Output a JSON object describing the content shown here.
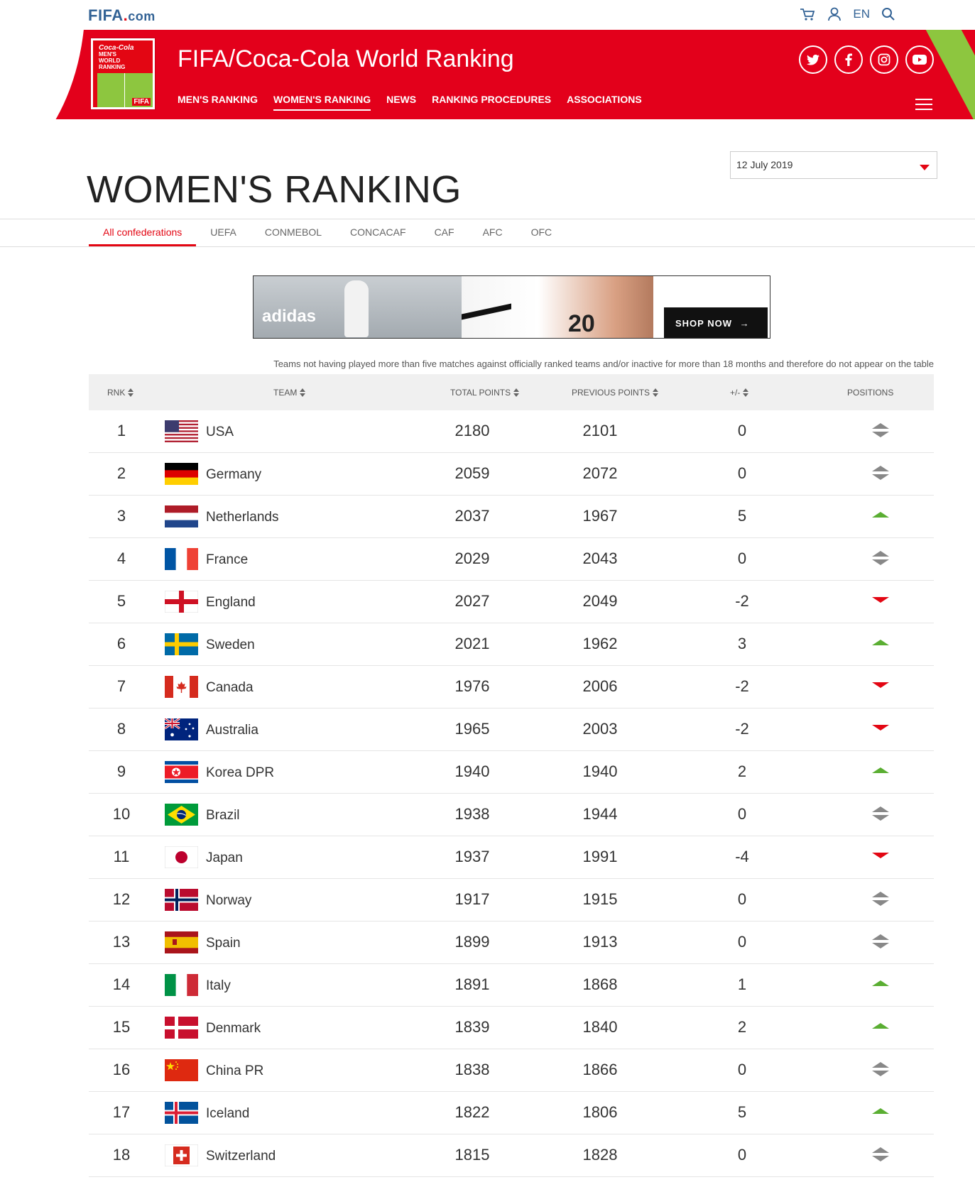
{
  "header": {
    "logo_main": "FIFA",
    "logo_dot": ".",
    "logo_suffix": "com",
    "language": "EN"
  },
  "banner": {
    "title": "FIFA/Coca-Cola World Ranking",
    "badge_lines": [
      "Coca-Cola",
      "MEN'S",
      "WORLD",
      "RANKING"
    ],
    "badge_fifa": "FIFA",
    "nav": [
      {
        "label": "MEN'S RANKING"
      },
      {
        "label": "WOMEN'S RANKING"
      },
      {
        "label": "NEWS"
      },
      {
        "label": "RANKING PROCEDURES"
      },
      {
        "label": "ASSOCIATIONS"
      }
    ],
    "active_nav": 1
  },
  "page": {
    "title": "WOMEN'S RANKING",
    "date": "12 July 2019"
  },
  "confederations": {
    "tabs": [
      "All confederations",
      "UEFA",
      "CONMEBOL",
      "CONCACAF",
      "CAF",
      "AFC",
      "OFC"
    ],
    "active": 0
  },
  "ad": {
    "brand": "adidas",
    "shirt_number": "20",
    "cta": "SHOP NOW"
  },
  "note": "Teams not having played more than five matches against officially ranked teams and/or inactive for more than 18 months and therefore do not appear on the table",
  "table": {
    "headers": {
      "rank": "RNK",
      "team": "TEAM",
      "total": "TOTAL POINTS",
      "previous": "PREVIOUS POINTS",
      "diff": "+/-",
      "positions": "POSITIONS"
    },
    "rows": [
      {
        "rank": "1",
        "team": "USA",
        "flag": "us",
        "total": "2180",
        "prev": "2101",
        "diff": "0",
        "trend": "same"
      },
      {
        "rank": "2",
        "team": "Germany",
        "flag": "de",
        "total": "2059",
        "prev": "2072",
        "diff": "0",
        "trend": "same"
      },
      {
        "rank": "3",
        "team": "Netherlands",
        "flag": "nl",
        "total": "2037",
        "prev": "1967",
        "diff": "5",
        "trend": "up"
      },
      {
        "rank": "4",
        "team": "France",
        "flag": "fr",
        "total": "2029",
        "prev": "2043",
        "diff": "0",
        "trend": "same"
      },
      {
        "rank": "5",
        "team": "England",
        "flag": "en",
        "total": "2027",
        "prev": "2049",
        "diff": "-2",
        "trend": "down"
      },
      {
        "rank": "6",
        "team": "Sweden",
        "flag": "se",
        "total": "2021",
        "prev": "1962",
        "diff": "3",
        "trend": "up"
      },
      {
        "rank": "7",
        "team": "Canada",
        "flag": "ca",
        "total": "1976",
        "prev": "2006",
        "diff": "-2",
        "trend": "down"
      },
      {
        "rank": "8",
        "team": "Australia",
        "flag": "au",
        "total": "1965",
        "prev": "2003",
        "diff": "-2",
        "trend": "down"
      },
      {
        "rank": "9",
        "team": "Korea DPR",
        "flag": "kp",
        "total": "1940",
        "prev": "1940",
        "diff": "2",
        "trend": "up"
      },
      {
        "rank": "10",
        "team": "Brazil",
        "flag": "br",
        "total": "1938",
        "prev": "1944",
        "diff": "0",
        "trend": "same"
      },
      {
        "rank": "11",
        "team": "Japan",
        "flag": "jp",
        "total": "1937",
        "prev": "1991",
        "diff": "-4",
        "trend": "down"
      },
      {
        "rank": "12",
        "team": "Norway",
        "flag": "no",
        "total": "1917",
        "prev": "1915",
        "diff": "0",
        "trend": "same"
      },
      {
        "rank": "13",
        "team": "Spain",
        "flag": "es",
        "total": "1899",
        "prev": "1913",
        "diff": "0",
        "trend": "same"
      },
      {
        "rank": "14",
        "team": "Italy",
        "flag": "it",
        "total": "1891",
        "prev": "1868",
        "diff": "1",
        "trend": "up"
      },
      {
        "rank": "15",
        "team": "Denmark",
        "flag": "dk",
        "total": "1839",
        "prev": "1840",
        "diff": "2",
        "trend": "up"
      },
      {
        "rank": "16",
        "team": "China PR",
        "flag": "cn",
        "total": "1838",
        "prev": "1866",
        "diff": "0",
        "trend": "same"
      },
      {
        "rank": "17",
        "team": "Iceland",
        "flag": "is",
        "total": "1822",
        "prev": "1806",
        "diff": "5",
        "trend": "up"
      },
      {
        "rank": "18",
        "team": "Switzerland",
        "flag": "ch",
        "total": "1815",
        "prev": "1828",
        "diff": "0",
        "trend": "same"
      }
    ]
  },
  "colors": {
    "fifa_red": "#e3001b",
    "fifa_blue": "#326295",
    "trend_up": "#5aae32",
    "trend_down": "#e30613",
    "trend_same": "#888888"
  }
}
